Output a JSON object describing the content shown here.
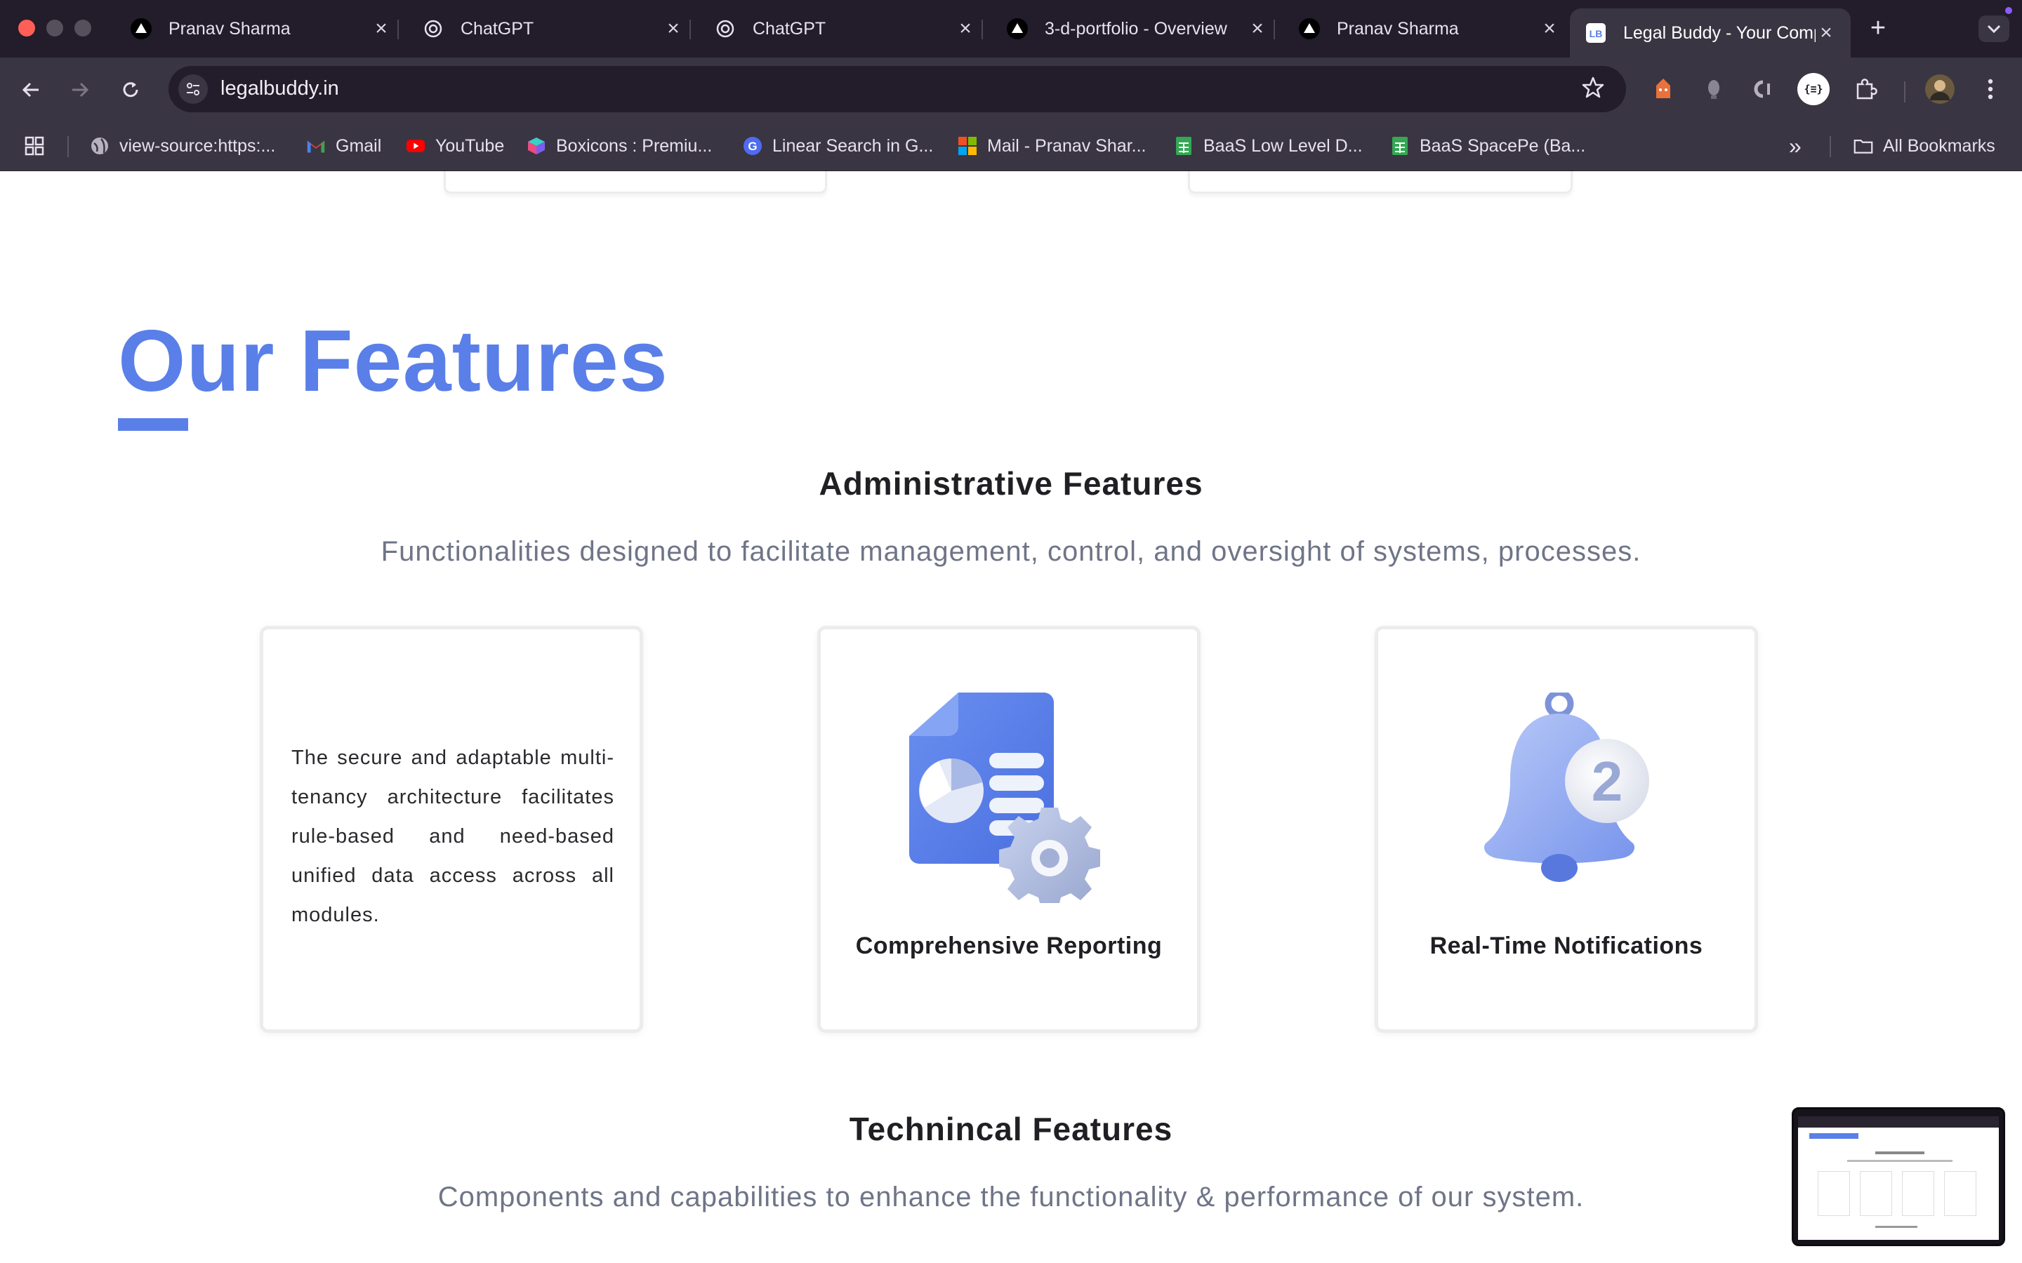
{
  "browser": {
    "tabs": [
      {
        "title": "Pranav Sharma",
        "icon": "triangle-icon",
        "active": false
      },
      {
        "title": "ChatGPT",
        "icon": "chatgpt-icon",
        "active": false
      },
      {
        "title": "ChatGPT",
        "icon": "chatgpt-icon",
        "active": false
      },
      {
        "title": "3-d-portfolio - Overview",
        "icon": "triangle-icon",
        "active": false
      },
      {
        "title": "Pranav Sharma",
        "icon": "triangle-icon",
        "active": false
      },
      {
        "title": "Legal Buddy - Your Company",
        "icon": "legalbuddy-icon",
        "active": true
      }
    ],
    "new_tab_label": "+",
    "url": "legalbuddy.in",
    "bookmarks": [
      {
        "label": "view-source:https:...",
        "icon": "globe-icon"
      },
      {
        "label": "Gmail",
        "icon": "gmail-icon"
      },
      {
        "label": "YouTube",
        "icon": "youtube-icon"
      },
      {
        "label": "Boxicons : Premiu...",
        "icon": "boxicons-icon"
      },
      {
        "label": "Linear Search in G...",
        "icon": "google-icon"
      },
      {
        "label": "Mail - Pranav Shar...",
        "icon": "microsoft-icon"
      },
      {
        "label": "BaaS Low Level D...",
        "icon": "sheets-icon"
      },
      {
        "label": "BaaS SpacePe (Ba...",
        "icon": "sheets-icon"
      }
    ],
    "overflow_label": "»",
    "all_bookmarks_label": "All Bookmarks"
  },
  "page": {
    "title": "Our Features",
    "admin": {
      "heading": "Administrative Features",
      "subheading": "Functionalities designed to facilitate management, control, and oversight of systems, processes.",
      "cards": [
        {
          "text": "The secure and adaptable multi-tenancy architecture facilitates rule-based and need-based unified data access across all modules."
        },
        {
          "label": "Comprehensive Reporting",
          "illustration": "report-gear-icon"
        },
        {
          "label": "Real-Time Notifications",
          "illustration": "notification-bell-icon"
        }
      ]
    },
    "technical": {
      "heading": "Technincal Features",
      "subheading": "Components and capabilities to enhance the functionality & performance of our system."
    }
  },
  "colors": {
    "brand_blue": "#5a7fe8",
    "chrome_dark": "#221c2b",
    "chrome_toolbar": "#3a3542"
  }
}
